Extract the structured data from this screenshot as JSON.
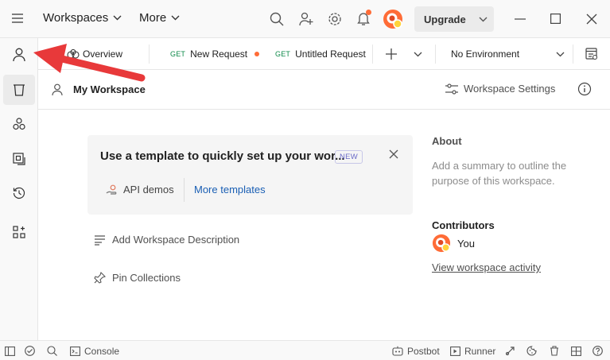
{
  "topbar": {
    "menu_workspaces": "Workspaces",
    "menu_more": "More",
    "upgrade_label": "Upgrade"
  },
  "tabs": [
    {
      "label": "Overview"
    },
    {
      "method": "GET",
      "label": "New Request"
    },
    {
      "method": "GET",
      "label": "Untitled Request"
    }
  ],
  "environment": {
    "selected": "No Environment"
  },
  "workspace": {
    "title": "My Workspace",
    "settings_label": "Workspace Settings"
  },
  "template_card": {
    "title": "Use a template to quickly set up your wor...",
    "badge": "NEW",
    "api_demos": "API demos",
    "more_templates": "More templates"
  },
  "actions": {
    "add_description": "Add Workspace Description",
    "pin_collections": "Pin Collections"
  },
  "about": {
    "heading": "About",
    "summary_placeholder": "Add a summary to outline the purpose of this workspace.",
    "contributors_heading": "Contributors",
    "contributor_name": "You",
    "activity_link": "View workspace activity"
  },
  "statusbar": {
    "console": "Console",
    "postbot": "Postbot",
    "runner": "Runner"
  },
  "colors": {
    "accent": "#ff6c37",
    "annotation_arrow": "#e8393a",
    "get_method": "#0f8a4a",
    "link_blue": "#1a5fb4"
  }
}
